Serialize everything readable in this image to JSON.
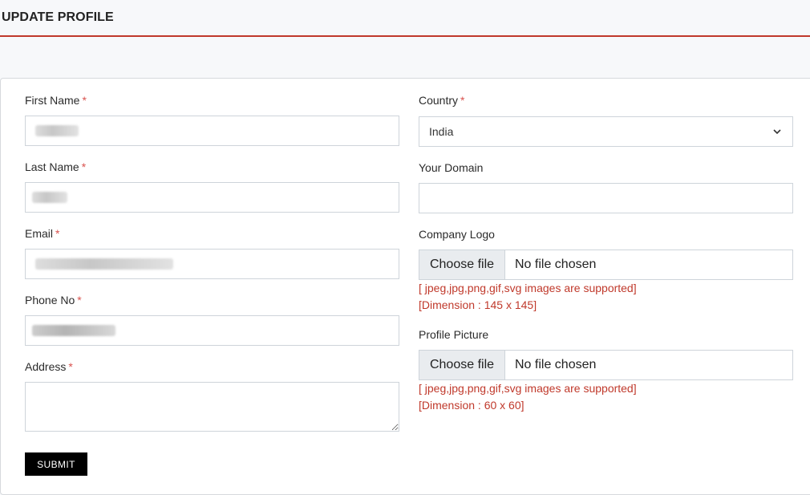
{
  "header": {
    "title": "UPDATE PROFILE"
  },
  "form": {
    "required_mark": "*",
    "first_name": {
      "label": "First Name"
    },
    "last_name": {
      "label": "Last Name"
    },
    "email": {
      "label": "Email"
    },
    "phone": {
      "label": "Phone No"
    },
    "address": {
      "label": "Address",
      "value": ""
    },
    "country": {
      "label": "Country",
      "value": "India"
    },
    "domain": {
      "label": "Your Domain",
      "value": ""
    },
    "company_logo": {
      "label": "Company Logo",
      "button": "Choose file",
      "file_name": "No file chosen",
      "hint_formats": "[ jpeg,jpg,png,gif,svg images are supported]",
      "hint_dimension": "[Dimension : 145 x 145]"
    },
    "profile_picture": {
      "label": "Profile Picture",
      "button": "Choose file",
      "file_name": "No file chosen",
      "hint_formats": "[ jpeg,jpg,png,gif,svg images are supported]",
      "hint_dimension": "[Dimension : 60 x 60]"
    },
    "submit_label": "SUBMIT"
  },
  "colors": {
    "accent": "#c0392b",
    "required": "#d9534f",
    "submit_bg": "#000000"
  },
  "icons": {
    "country_dropdown": "chevron-down-icon"
  }
}
